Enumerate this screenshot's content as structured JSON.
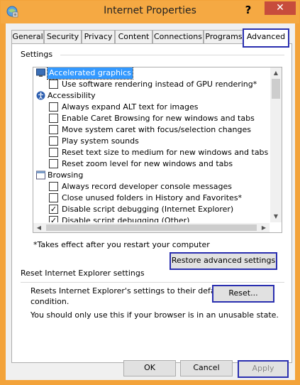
{
  "window": {
    "title": "Internet Properties",
    "help_label": "?",
    "close_label": "✕"
  },
  "tabs": [
    {
      "label": "General"
    },
    {
      "label": "Security"
    },
    {
      "label": "Privacy"
    },
    {
      "label": "Content"
    },
    {
      "label": "Connections"
    },
    {
      "label": "Programs"
    },
    {
      "label": "Advanced",
      "active": true
    }
  ],
  "settings": {
    "group_label": "Settings",
    "items": [
      {
        "type": "category",
        "icon": "monitor-icon",
        "label": "Accelerated graphics",
        "selected": true
      },
      {
        "type": "checkbox",
        "label": "Use software rendering instead of GPU rendering*",
        "checked": false
      },
      {
        "type": "category",
        "icon": "accessibility-icon",
        "label": "Accessibility"
      },
      {
        "type": "checkbox",
        "label": "Always expand ALT text for images",
        "checked": false
      },
      {
        "type": "checkbox",
        "label": "Enable Caret Browsing for new windows and tabs",
        "checked": false
      },
      {
        "type": "checkbox",
        "label": "Move system caret with focus/selection changes",
        "checked": false
      },
      {
        "type": "checkbox",
        "label": "Play system sounds",
        "checked": false
      },
      {
        "type": "checkbox",
        "label": "Reset text size to medium for new windows and tabs",
        "checked": false
      },
      {
        "type": "checkbox",
        "label": "Reset zoom level for new windows and tabs",
        "checked": false
      },
      {
        "type": "category",
        "icon": "browsing-icon",
        "label": "Browsing"
      },
      {
        "type": "checkbox",
        "label": "Always record developer console messages",
        "checked": false
      },
      {
        "type": "checkbox",
        "label": "Close unused folders in History and Favorites*",
        "checked": false
      },
      {
        "type": "checkbox",
        "label": "Disable script debugging (Internet Explorer)",
        "checked": true
      },
      {
        "type": "checkbox",
        "label": "Disable script debugging (Other)",
        "checked": true
      }
    ],
    "note": "*Takes effect after you restart your computer",
    "restore_button": "Restore advanced settings"
  },
  "reset": {
    "group_label": "Reset Internet Explorer settings",
    "description_line1": "Resets Internet Explorer's settings to their default",
    "description_line2": "condition.",
    "reset_button": "Reset...",
    "warning": "You should only use this if your browser is in an unusable state."
  },
  "footer": {
    "ok": "OK",
    "cancel": "Cancel",
    "apply": "Apply"
  },
  "colors": {
    "title_bar": "#f5a943",
    "close_button": "#c74c3c",
    "highlight_border": "#2a2fb0",
    "selection": "#3399ff"
  }
}
